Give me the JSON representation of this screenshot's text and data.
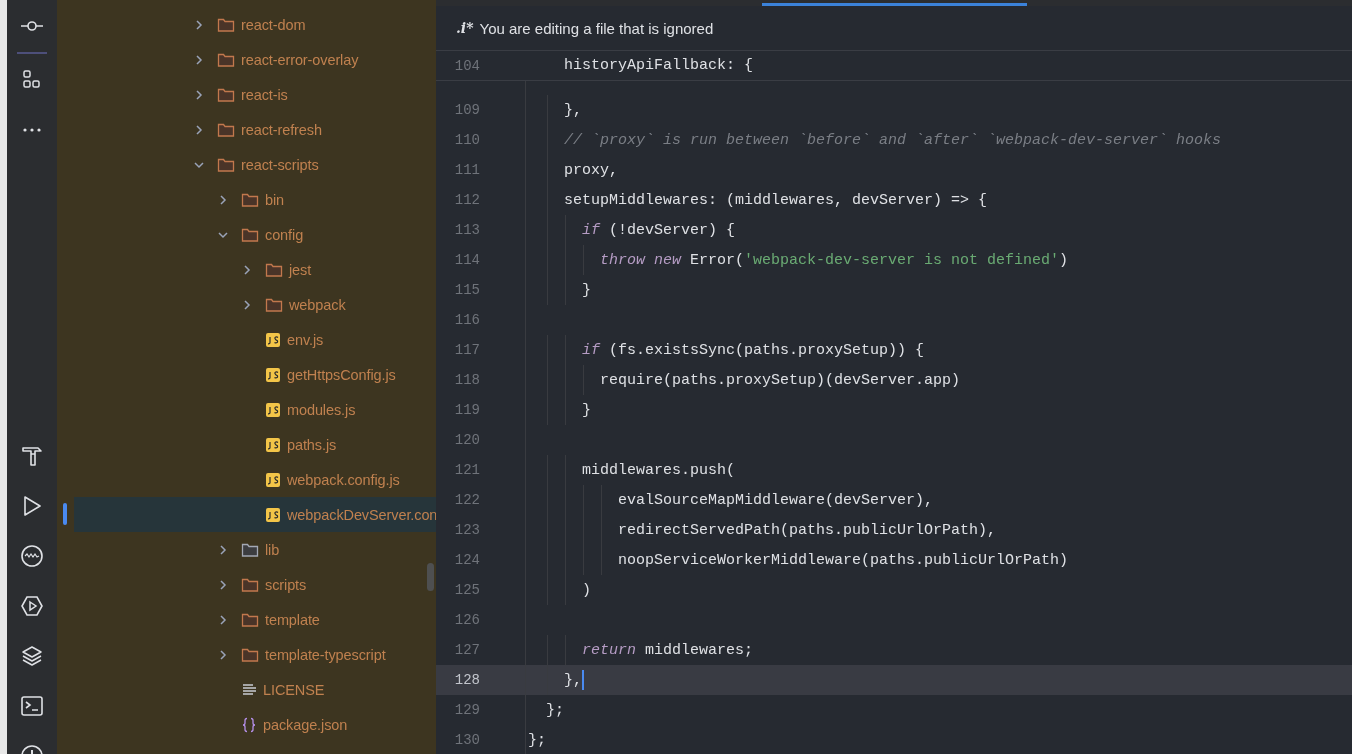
{
  "activity_bar": {
    "top": [
      {
        "kind": "commit"
      },
      {
        "kind": "structure"
      },
      {
        "kind": "more"
      }
    ],
    "bottom": [
      {
        "kind": "build"
      },
      {
        "kind": "run"
      },
      {
        "kind": "profiler"
      },
      {
        "kind": "services"
      },
      {
        "kind": "layers"
      },
      {
        "kind": "terminal"
      },
      {
        "kind": "problems"
      }
    ]
  },
  "project_tree": [
    {
      "label": "react-dom",
      "kind": "folder",
      "expanded": false,
      "selected": false
    },
    {
      "label": "react-error-overlay",
      "kind": "folder",
      "expanded": false,
      "selected": false
    },
    {
      "label": "react-is",
      "kind": "folder",
      "expanded": false,
      "selected": false
    },
    {
      "label": "react-refresh",
      "kind": "folder",
      "expanded": false,
      "selected": false
    },
    {
      "label": "react-scripts",
      "kind": "folder",
      "expanded": true,
      "selected": false,
      "children": [
        {
          "label": "bin",
          "kind": "folder",
          "expanded": false,
          "selected": false
        },
        {
          "label": "config",
          "kind": "folder",
          "expanded": true,
          "selected": false,
          "children": [
            {
              "label": "jest",
              "kind": "folder",
              "expanded": false,
              "selected": false
            },
            {
              "label": "webpack",
              "kind": "folder",
              "expanded": false,
              "selected": false
            },
            {
              "label": "env.js",
              "kind": "js",
              "selected": false
            },
            {
              "label": "getHttpsConfig.js",
              "kind": "js",
              "selected": false
            },
            {
              "label": "modules.js",
              "kind": "js",
              "selected": false
            },
            {
              "label": "paths.js",
              "kind": "js",
              "selected": false
            },
            {
              "label": "webpack.config.js",
              "kind": "js",
              "selected": false
            },
            {
              "label": "webpackDevServer.con",
              "kind": "js",
              "selected": true
            }
          ]
        },
        {
          "label": "lib",
          "kind": "source-folder",
          "expanded": false,
          "selected": false
        },
        {
          "label": "scripts",
          "kind": "folder",
          "expanded": false,
          "selected": false
        },
        {
          "label": "template",
          "kind": "folder",
          "expanded": false,
          "selected": false
        },
        {
          "label": "template-typescript",
          "kind": "folder",
          "expanded": false,
          "selected": false
        },
        {
          "label": "LICENSE",
          "kind": "text",
          "selected": false
        },
        {
          "label": "package.json",
          "kind": "json",
          "selected": false
        }
      ]
    }
  ],
  "editor": {
    "notice": {
      "badge": ".i*",
      "text": "You are editing a file that is ignored"
    },
    "sticky_line": {
      "number": "104",
      "tokens": [
        {
          "text": "    historyApiFallback: {",
          "kind": "plain"
        }
      ]
    },
    "lines": [
      {
        "number": "109",
        "current": false,
        "tokens": [
          {
            "text": "    },",
            "kind": "plain"
          }
        ]
      },
      {
        "number": "110",
        "current": false,
        "tokens": [
          {
            "text": "    // `proxy` is run between `before` and `after` `webpack-dev-server` hooks",
            "kind": "comment"
          }
        ]
      },
      {
        "number": "111",
        "current": false,
        "tokens": [
          {
            "text": "    proxy,",
            "kind": "plain"
          }
        ]
      },
      {
        "number": "112",
        "current": false,
        "tokens": [
          {
            "text": "    setupMiddlewares: (middlewares, devServer) => {",
            "kind": "plain"
          }
        ]
      },
      {
        "number": "113",
        "current": false,
        "tokens": [
          {
            "text": "      if",
            "kind": "keyword"
          },
          {
            "text": " (!devServer) {",
            "kind": "plain"
          }
        ]
      },
      {
        "number": "114",
        "current": false,
        "tokens": [
          {
            "text": "        throw new",
            "kind": "keyword"
          },
          {
            "text": " Error(",
            "kind": "plain"
          },
          {
            "text": "'webpack-dev-server is not defined'",
            "kind": "string"
          },
          {
            "text": ")",
            "kind": "plain"
          }
        ]
      },
      {
        "number": "115",
        "current": false,
        "tokens": [
          {
            "text": "      }",
            "kind": "plain"
          }
        ]
      },
      {
        "number": "116",
        "current": false
      },
      {
        "number": "117",
        "current": false,
        "tokens": [
          {
            "text": "      if",
            "kind": "keyword"
          },
          {
            "text": " (fs.existsSync(paths.proxySetup)) {",
            "kind": "plain"
          }
        ]
      },
      {
        "number": "118",
        "current": false,
        "tokens": [
          {
            "text": "        require(paths.proxySetup)(devServer.app)",
            "kind": "plain"
          }
        ]
      },
      {
        "number": "119",
        "current": false,
        "tokens": [
          {
            "text": "      }",
            "kind": "plain"
          }
        ]
      },
      {
        "number": "120",
        "current": false
      },
      {
        "number": "121",
        "current": false,
        "tokens": [
          {
            "text": "      middlewares.push(",
            "kind": "plain"
          }
        ]
      },
      {
        "number": "122",
        "current": false,
        "tokens": [
          {
            "text": "          evalSourceMapMiddleware(devServer),",
            "kind": "plain"
          }
        ]
      },
      {
        "number": "123",
        "current": false,
        "tokens": [
          {
            "text": "          redirectServedPath(paths.publicUrlOrPath),",
            "kind": "plain"
          }
        ]
      },
      {
        "number": "124",
        "current": false,
        "tokens": [
          {
            "text": "          noopServiceWorkerMiddleware(paths.publicUrlOrPath)",
            "kind": "plain"
          }
        ]
      },
      {
        "number": "125",
        "current": false,
        "tokens": [
          {
            "text": "      )",
            "kind": "plain"
          }
        ]
      },
      {
        "number": "126",
        "current": false
      },
      {
        "number": "127",
        "current": false,
        "tokens": [
          {
            "text": "      return",
            "kind": "keyword"
          },
          {
            "text": " middlewares;",
            "kind": "plain"
          }
        ]
      },
      {
        "number": "128",
        "current": true,
        "tokens": [
          {
            "text": "    },",
            "kind": "plain"
          }
        ]
      },
      {
        "number": "129",
        "current": false,
        "tokens": [
          {
            "text": "  };",
            "kind": "plain"
          }
        ]
      },
      {
        "number": "130",
        "current": false,
        "tokens": [
          {
            "text": "};",
            "kind": "plain"
          }
        ]
      }
    ]
  }
}
